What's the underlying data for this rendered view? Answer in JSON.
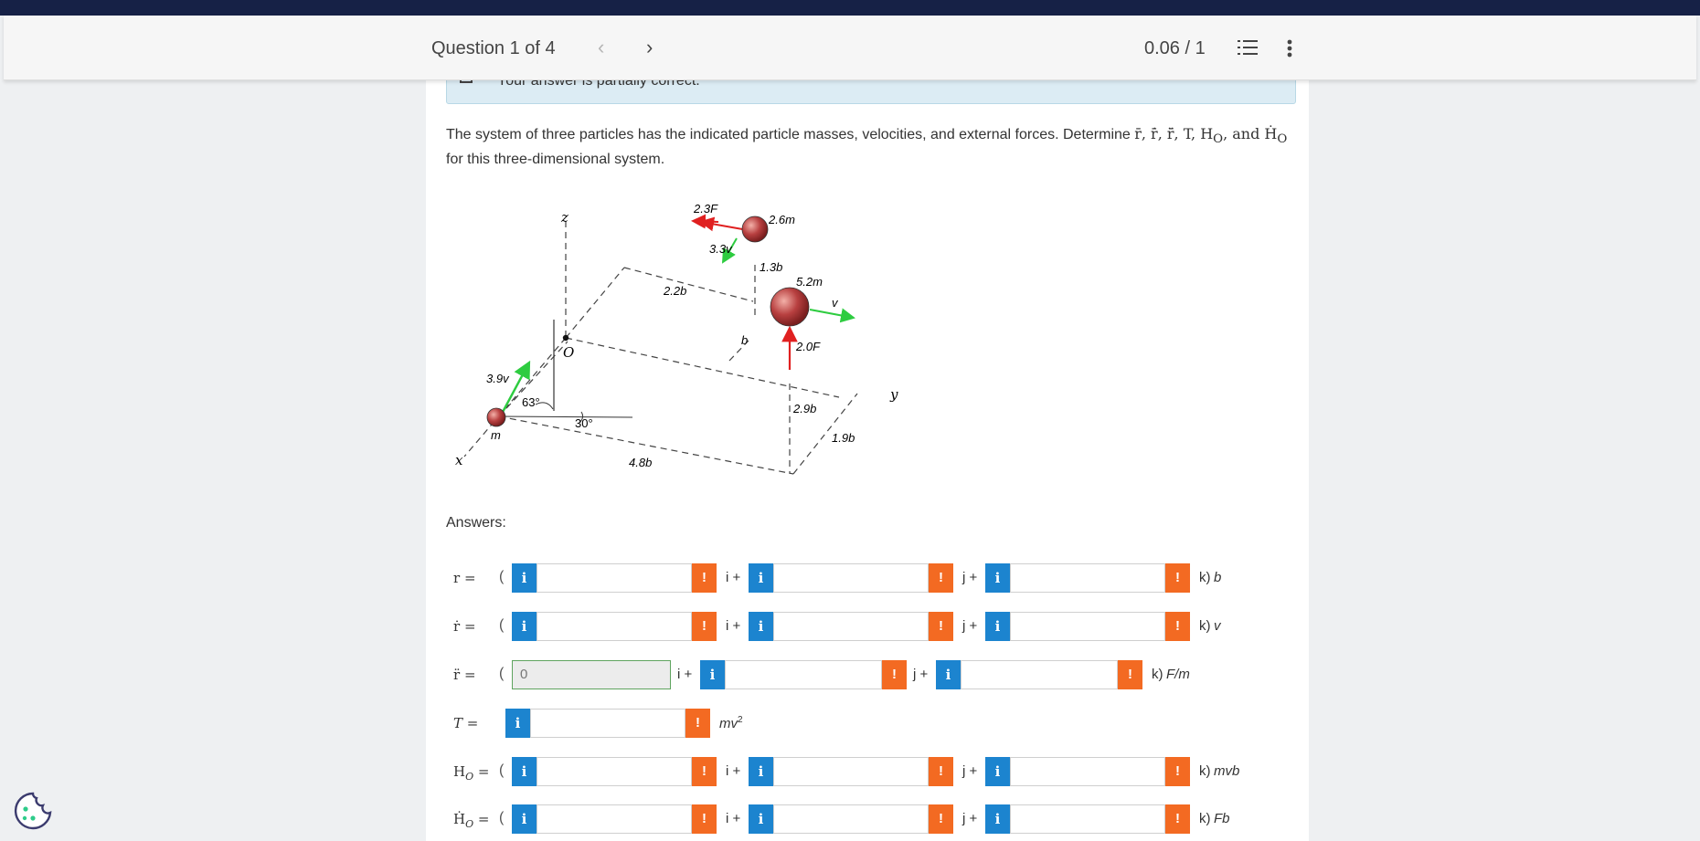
{
  "header": {
    "question_counter": "Question 1 of 4",
    "prev_icon": "chevron-left-icon",
    "next_icon": "chevron-right-icon",
    "score": "0.06 / 1",
    "list_icon": "list-icon",
    "menu_icon": "kebab-menu-icon"
  },
  "banner": {
    "text": "Your answer is partially correct."
  },
  "question": {
    "text_before": "The system of three particles has the indicated particle masses, velocities, and external forces. Determine ",
    "symbols": "r̄, ṙ̄, r̈̄, T, H",
    "sub_o": "O",
    "and": ", and Ḣ",
    "text_after": " for this three-dimensional system."
  },
  "figure": {
    "labels": {
      "force_top": "2.3F",
      "mass_top": "2.6m",
      "vel_top": "3.3v",
      "dim_13b": "1.3b",
      "mass_mid": "5.2m",
      "vel_mid": "v",
      "dim_22b": "2.2b",
      "dim_b": "b",
      "force_mid": "2.0F",
      "axis_z": "z",
      "origin": "O",
      "vel_left": "3.9v",
      "angle_63": "63°",
      "angle_30": "30°",
      "mass_left": "m",
      "axis_x": "x",
      "dim_48b": "4.8b",
      "dim_29b": "2.9b",
      "dim_19b": "1.9b",
      "axis_y": "y"
    },
    "colors": {
      "particle": "#b84040",
      "force": "#e02020",
      "velocity": "#2ecc40",
      "dash": "#444444"
    }
  },
  "answers": {
    "label": "Answers:",
    "info_glyph": "i",
    "warn_glyph": "!",
    "rows": [
      {
        "label": "r =",
        "open": "(",
        "i": "i +",
        "j": "j +",
        "k": "k)",
        "unit": "b",
        "values": [
          "",
          "",
          ""
        ]
      },
      {
        "label": "ṙ =",
        "open": "(",
        "i": "i +",
        "j": "j +",
        "k": "k)",
        "unit": "v",
        "values": [
          "",
          "",
          ""
        ]
      },
      {
        "label": "r̈ =",
        "open": "(",
        "i": "i +",
        "j": "j +",
        "k": "k)",
        "unit": "F/m",
        "values": [
          "0",
          "",
          ""
        ]
      },
      {
        "label": "T =",
        "unit": "mv",
        "unit_sup": "2",
        "values": [
          ""
        ]
      },
      {
        "label": "H",
        "label_sub": "O",
        "label_tail": " =",
        "open": "(",
        "i": "i +",
        "j": "j +",
        "k": "k)",
        "unit": "mvb",
        "values": [
          "",
          "",
          ""
        ]
      },
      {
        "label": "Ḣ",
        "label_sub": "O",
        "label_tail": " =",
        "open": "(",
        "i": "i +",
        "j": "j +",
        "k": "k)",
        "unit": "Fb",
        "values": [
          "",
          "",
          ""
        ]
      }
    ]
  },
  "cookie": {
    "icon": "cookie-icon"
  }
}
